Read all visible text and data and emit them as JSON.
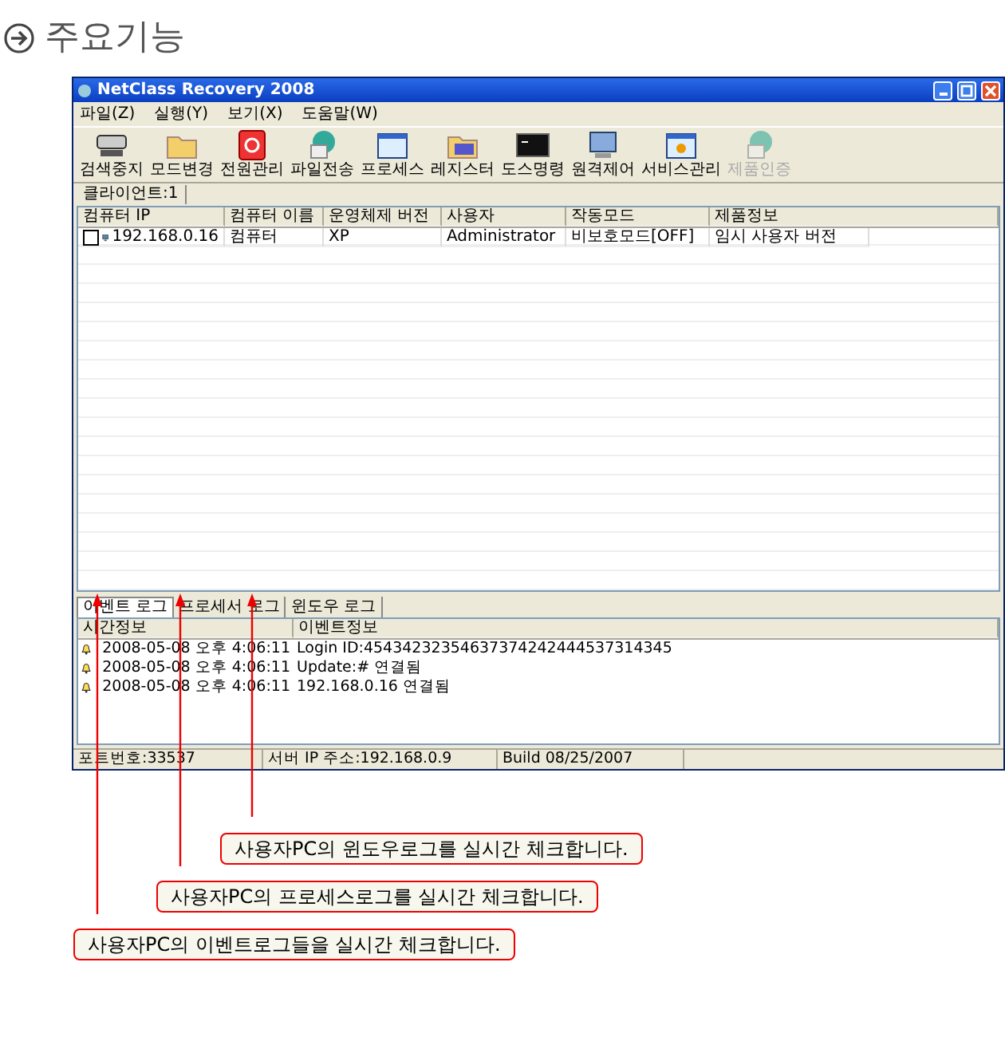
{
  "heading": "주요기능",
  "window": {
    "title": "NetClass Recovery 2008"
  },
  "menu": [
    "파일(Z)",
    "실행(Y)",
    "보기(X)",
    "도움말(W)"
  ],
  "toolbar": [
    {
      "label": "검색중지",
      "disabled": false
    },
    {
      "label": "모드변경",
      "disabled": false
    },
    {
      "label": "전원관리",
      "disabled": false
    },
    {
      "label": "파일전송",
      "disabled": false
    },
    {
      "label": "프로세스",
      "disabled": false
    },
    {
      "label": "레지스터",
      "disabled": false
    },
    {
      "label": "도스명령",
      "disabled": false
    },
    {
      "label": "원격제어",
      "disabled": false
    },
    {
      "label": "서비스관리",
      "disabled": false
    },
    {
      "label": "제품인증",
      "disabled": true
    }
  ],
  "client_tab": "클라이언트:1",
  "clients": {
    "columns": [
      "컴퓨터 IP",
      "컴퓨터 이름",
      "운영체제 버전",
      "사용자",
      "작동모드",
      "제품정보"
    ],
    "rows": [
      {
        "checked": false,
        "cells": [
          "192.168.0.16",
          "컴퓨터",
          "XP",
          "Administrator",
          "비보호모드[OFF]",
          "임시 사용자 버전"
        ]
      }
    ]
  },
  "log_tabs": [
    {
      "label": "이벤트 로그",
      "selected": true
    },
    {
      "label": "프로세서 로그",
      "selected": false
    },
    {
      "label": "윈도우 로그",
      "selected": false
    }
  ],
  "log": {
    "columns": [
      "시간정보",
      "이벤트정보"
    ],
    "rows": [
      [
        "2008-05-08 오후 4:06:11",
        "Login ID:45434232354637374242444537314345"
      ],
      [
        "2008-05-08 오후 4:06:11",
        "Update:# 연결됨"
      ],
      [
        "2008-05-08 오후 4:06:11",
        "192.168.0.16 연결됨"
      ]
    ]
  },
  "status_bar": [
    "포트번호:33537",
    "서버 IP 주소:192.168.0.9",
    "Build 08/25/2007"
  ],
  "callouts": [
    "사용자PC의 윈도우로그를 실시간 체크합니다.",
    "사용자PC의 프로세스로그를 실시간 체크합니다.",
    "사용자PC의 이벤트로그들을 실시간 체크합니다."
  ]
}
